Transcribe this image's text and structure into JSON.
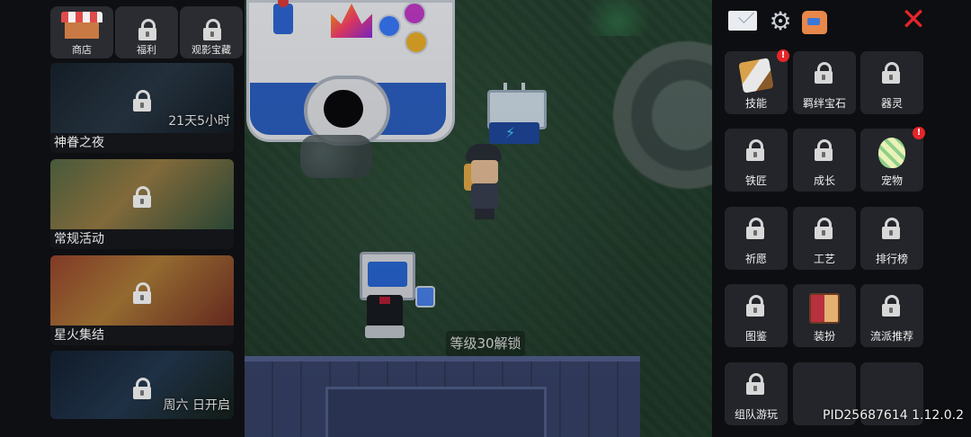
{
  "left_panel": {
    "top_buttons": [
      {
        "label": "商店",
        "icon": "shop-icon",
        "locked": false
      },
      {
        "label": "福利",
        "icon": "lock-icon",
        "locked": true
      },
      {
        "label": "观影宝藏",
        "icon": "lock-icon",
        "locked": true
      }
    ],
    "event_cards": [
      {
        "title": "神眷之夜",
        "timer": "21天5小时",
        "locked": true
      },
      {
        "title": "常规活动",
        "timer": "",
        "locked": true
      },
      {
        "title": "星火集结",
        "timer": "",
        "locked": true
      },
      {
        "title": "",
        "timer": "周六 日开启",
        "locked": true
      }
    ]
  },
  "game_world": {
    "unlock_hint": "等级30解锁"
  },
  "right_panel": {
    "header_icons": [
      "mail-icon",
      "gear-icon",
      "bag-icon",
      "close-icon"
    ],
    "grid": [
      {
        "label": "技能",
        "icon": "sword-icon",
        "locked": false,
        "alert": "!"
      },
      {
        "label": "羁绊宝石",
        "icon": "lock-icon",
        "locked": true,
        "alert": ""
      },
      {
        "label": "器灵",
        "icon": "lock-icon",
        "locked": true,
        "alert": ""
      },
      {
        "label": "铁匠",
        "icon": "lock-icon",
        "locked": true,
        "alert": ""
      },
      {
        "label": "成长",
        "icon": "lock-icon",
        "locked": true,
        "alert": ""
      },
      {
        "label": "宠物",
        "icon": "egg-icon",
        "locked": false,
        "alert": "!"
      },
      {
        "label": "祈愿",
        "icon": "lock-icon",
        "locked": true,
        "alert": ""
      },
      {
        "label": "工艺",
        "icon": "lock-icon",
        "locked": true,
        "alert": ""
      },
      {
        "label": "排行榜",
        "icon": "lock-icon",
        "locked": true,
        "alert": ""
      },
      {
        "label": "图鉴",
        "icon": "lock-icon",
        "locked": true,
        "alert": ""
      },
      {
        "label": "装扮",
        "icon": "wardrobe-icon",
        "locked": false,
        "alert": ""
      },
      {
        "label": "流派推荐",
        "icon": "lock-icon",
        "locked": true,
        "alert": ""
      },
      {
        "label": "组队游玩",
        "icon": "lock-icon",
        "locked": true,
        "alert": ""
      },
      {
        "label": "",
        "icon": "",
        "locked": false,
        "alert": ""
      },
      {
        "label": "",
        "icon": "",
        "locked": false,
        "alert": ""
      }
    ],
    "footer": "PID25687614 1.12.0.2"
  },
  "colors": {
    "alert_red": "#e3262a",
    "panel_bg": "#0d0e11",
    "cell_bg": "#23252a",
    "grass": "#24412f"
  }
}
